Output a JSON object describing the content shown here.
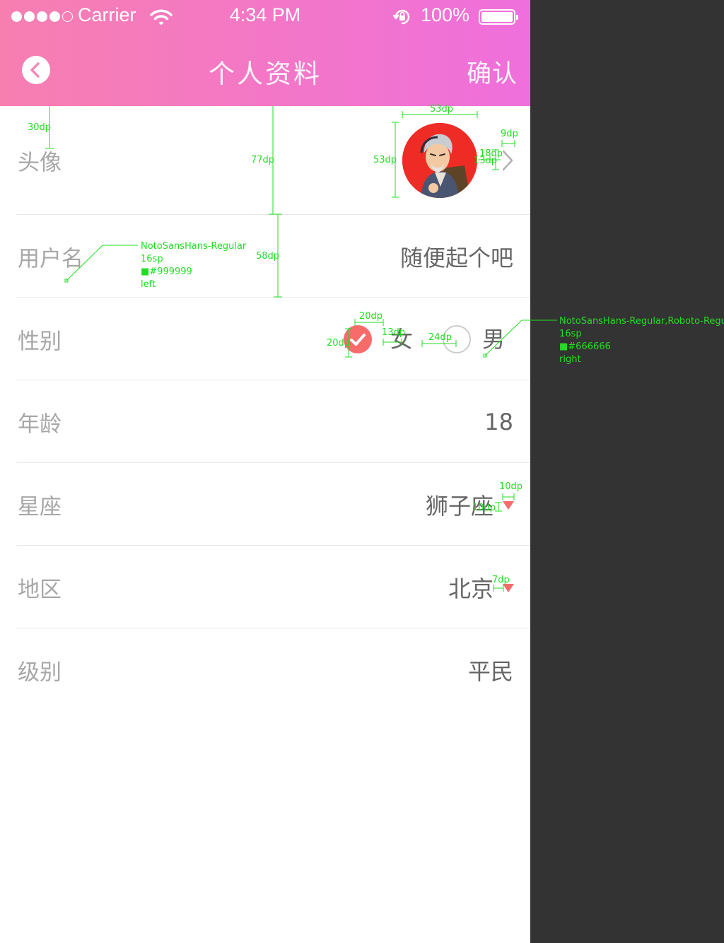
{
  "status_bar": {
    "carrier": "Carrier",
    "time": "4:34 PM",
    "battery": "100%",
    "signal_strength": "4 of 5 bars"
  },
  "nav": {
    "title": "个人资料",
    "confirm_label": "确认"
  },
  "rows": {
    "avatar": {
      "label": "头像"
    },
    "username": {
      "label": "用户名",
      "value": "随便起个吧"
    },
    "gender": {
      "label": "性别",
      "female": "女",
      "male": "男",
      "selected": "女"
    },
    "age": {
      "label": "年龄",
      "value": "18"
    },
    "zodiac": {
      "label": "星座",
      "value": "狮子座"
    },
    "region": {
      "label": "地区",
      "value": "北京"
    },
    "level": {
      "label": "级别",
      "value": "平民"
    }
  },
  "spec_annotations": {
    "avatar_top_gap": "30dp",
    "avatar_width": "53dp",
    "avatar_height": "53dp",
    "avatar_row_height": "77dp",
    "chevron_width": "9dp",
    "chevron_height": "18dp",
    "chevron_gap": "13dp",
    "row_height": "58dp",
    "label_font_note": "NotoSansHans-Regular\n16sp\n■#999999\nleft",
    "radio_width": "20dp",
    "radio_height": "20dp",
    "radio_text_gap": "13dp",
    "option_gap": "24dp",
    "value_font_note": "NotoSansHans-Regular,Roboto-Regu\n16sp\n■#666666\nright",
    "zodiac_arrow_width": "10dp",
    "zodiac_arrow_gap": "10dp",
    "region_arrow_gap": "7dp"
  },
  "colors": {
    "header_start": "#f77fb0",
    "header_end": "#ef6fdc",
    "accent": "#f76b6b",
    "label": "#999999",
    "value": "#666666",
    "annotation": "#22dd22",
    "backdrop": "#333333"
  }
}
